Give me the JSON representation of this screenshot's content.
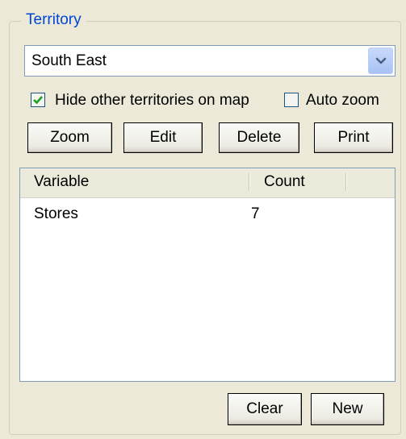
{
  "group": {
    "title": "Territory"
  },
  "territory_select": {
    "value": "South East",
    "icon": "chevron-down-icon"
  },
  "options": {
    "hide_other": {
      "label": "Hide other territories on map",
      "checked": true
    },
    "auto_zoom": {
      "label": "Auto zoom",
      "checked": false
    }
  },
  "buttons": {
    "zoom": "Zoom",
    "edit": "Edit",
    "delete": "Delete",
    "print": "Print",
    "clear": "Clear",
    "new": "New"
  },
  "table": {
    "columns": [
      "Variable",
      "Count"
    ],
    "rows": [
      {
        "variable": "Stores",
        "count": "7"
      }
    ]
  },
  "colors": {
    "title": "#0046d5",
    "panel": "#ece9d8",
    "check": "#21a121"
  }
}
